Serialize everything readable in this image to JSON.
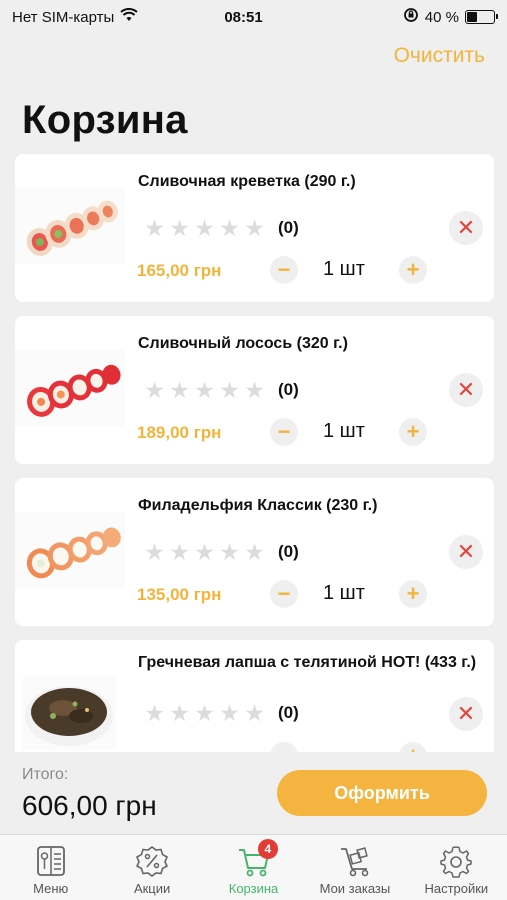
{
  "status_bar": {
    "carrier": "Нет SIM-карты",
    "time": "08:51",
    "battery_percent": "40 %",
    "battery_level": 0.4
  },
  "header": {
    "clear_label": "Очистить",
    "title": "Корзина"
  },
  "cart": {
    "items": [
      {
        "name": "Сливочная креветка (290 г.)",
        "rating_count": "(0)",
        "rating": 0,
        "price": "165,00 грн",
        "quantity": "1 шт",
        "image": "cream-shrimp-roll"
      },
      {
        "name": "Сливочный лосось (320 г.)",
        "rating_count": "(0)",
        "rating": 0,
        "price": "189,00 грн",
        "quantity": "1 шт",
        "image": "cream-salmon-roll"
      },
      {
        "name": "Филадельфия Классик (230 г.)",
        "rating_count": "(0)",
        "rating": 0,
        "price": "135,00 грн",
        "quantity": "1 шт",
        "image": "philadelphia-classic-roll"
      },
      {
        "name": "Гречневая лапша с телятиной HOT! (433 г.)",
        "rating_count": "(0)",
        "rating": 0,
        "price": "",
        "quantity": "",
        "image": "buckwheat-noodles-bowl"
      }
    ]
  },
  "summary": {
    "total_label": "Итого:",
    "total_value": "606,00 грн",
    "checkout_label": "Оформить"
  },
  "tabs": [
    {
      "label": "Меню",
      "icon": "menu-book-icon"
    },
    {
      "label": "Акции",
      "icon": "discount-icon"
    },
    {
      "label": "Корзина",
      "icon": "cart-icon",
      "badge": "4",
      "active": true
    },
    {
      "label": "Мои заказы",
      "icon": "orders-icon"
    },
    {
      "label": "Настройки",
      "icon": "settings-gear-icon"
    }
  ],
  "colors": {
    "accent": "#f4b43f",
    "active_tab": "#46b56b",
    "badge": "#e33b35",
    "remove": "#e0463d"
  }
}
